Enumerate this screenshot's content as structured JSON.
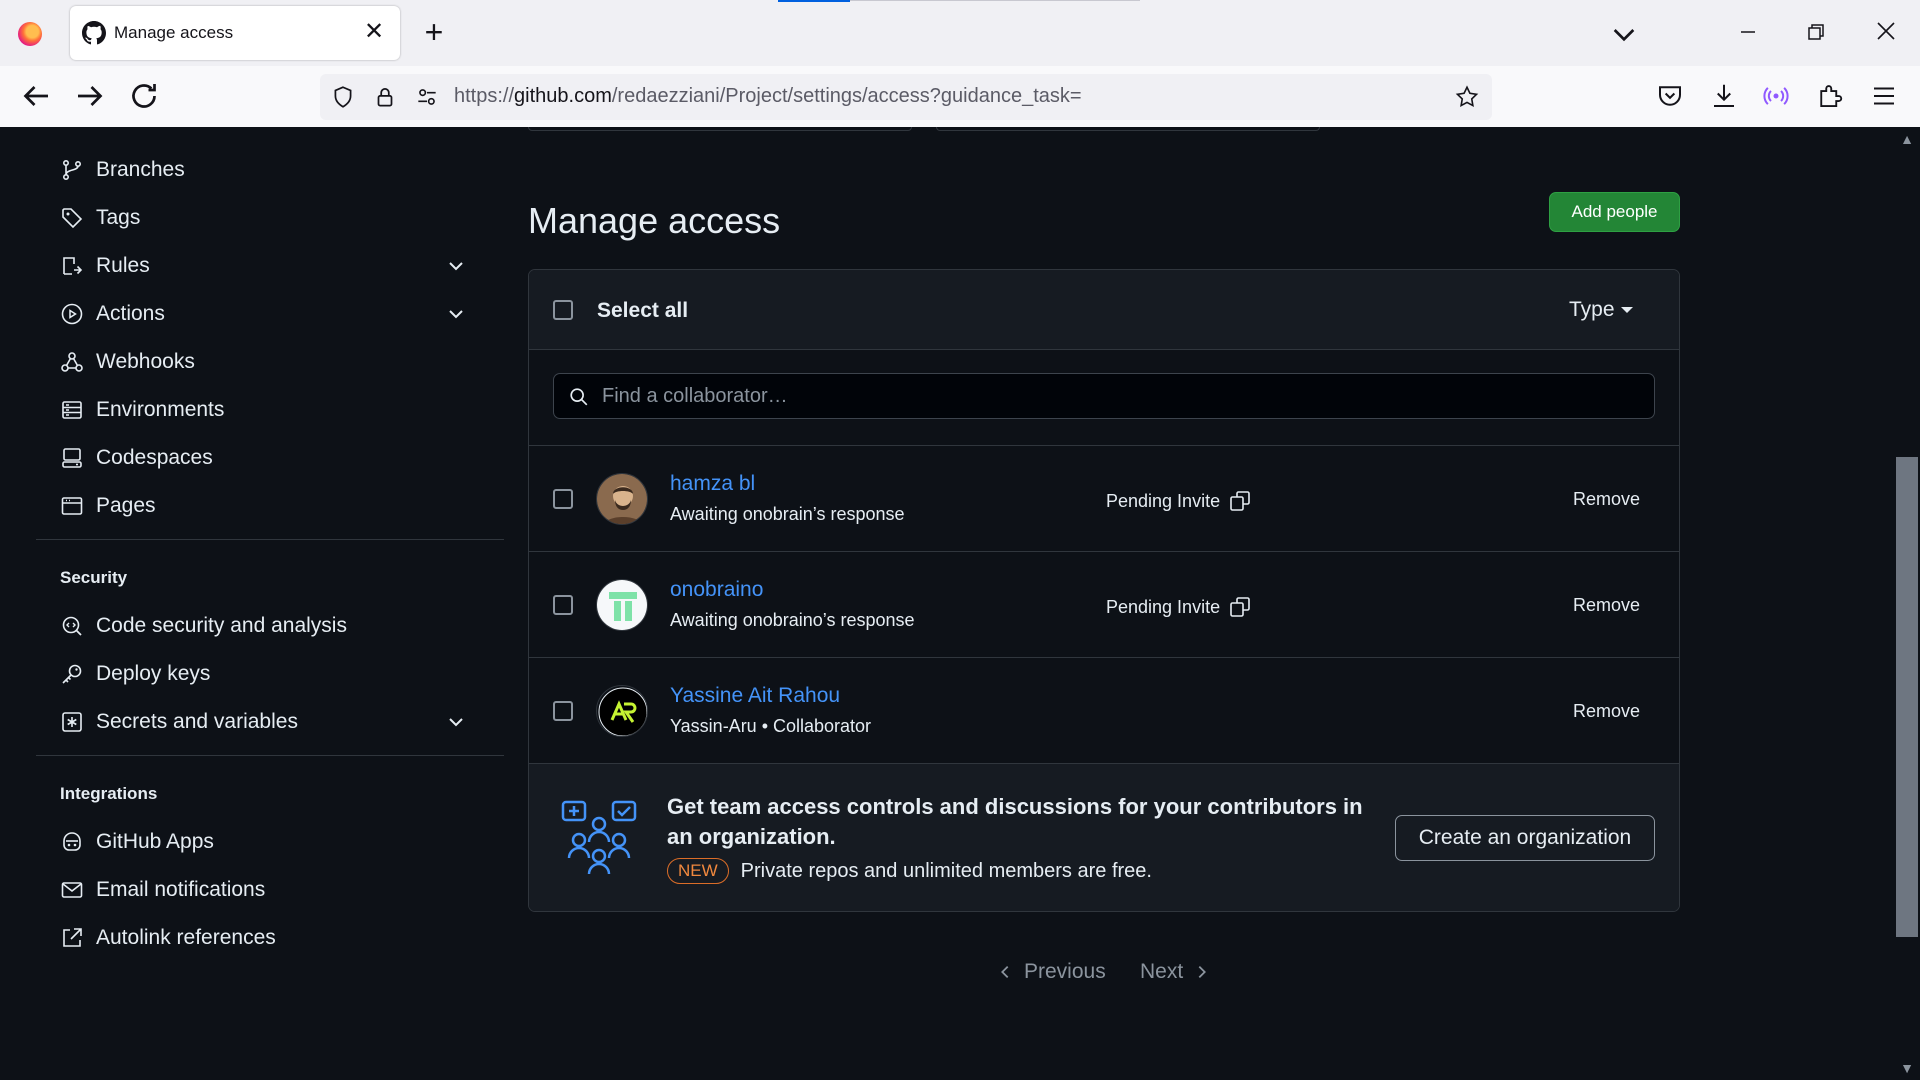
{
  "browser": {
    "tab_title": "Manage access",
    "url_prefix": "https://",
    "url_host": "github.com",
    "url_path": "/redaezziani/Project/settings/access?guidance_task="
  },
  "sidebar": {
    "code_items": [
      {
        "label": "Branches",
        "icon": "git-branch-icon"
      },
      {
        "label": "Tags",
        "icon": "tag-icon"
      },
      {
        "label": "Rules",
        "icon": "rules-icon",
        "expandable": true
      },
      {
        "label": "Actions",
        "icon": "play-icon",
        "expandable": true
      },
      {
        "label": "Webhooks",
        "icon": "webhook-icon"
      },
      {
        "label": "Environments",
        "icon": "server-icon"
      },
      {
        "label": "Codespaces",
        "icon": "codespaces-icon"
      },
      {
        "label": "Pages",
        "icon": "browser-icon"
      }
    ],
    "security_heading": "Security",
    "security_items": [
      {
        "label": "Code security and analysis",
        "icon": "codescan-icon"
      },
      {
        "label": "Deploy keys",
        "icon": "key-icon"
      },
      {
        "label": "Secrets and variables",
        "icon": "asterisk-icon",
        "expandable": true
      }
    ],
    "integrations_heading": "Integrations",
    "integrations_items": [
      {
        "label": "GitHub Apps",
        "icon": "apps-icon"
      },
      {
        "label": "Email notifications",
        "icon": "mail-icon"
      },
      {
        "label": "Autolink references",
        "icon": "link-external-icon"
      }
    ]
  },
  "main": {
    "title": "Manage access",
    "add_people_label": "Add people",
    "select_all_label": "Select all",
    "type_filter_label": "Type",
    "search_placeholder": "Find a collaborator…",
    "collaborators": [
      {
        "name": "hamza bl",
        "subtitle": "Awaiting onobrain’s response",
        "status": "Pending Invite",
        "action": "Remove"
      },
      {
        "name": "onobraino",
        "subtitle": "Awaiting onobraino’s response",
        "status": "Pending Invite",
        "action": "Remove"
      },
      {
        "name": "Yassine Ait Rahou",
        "subtitle": "Yassin-Aru • Collaborator",
        "status": "",
        "action": "Remove"
      }
    ],
    "promo": {
      "text": "Get team access controls and discussions for your contributors in an organization.",
      "badge": "NEW",
      "sub": "Private repos and unlimited members are free.",
      "button": "Create an organization"
    },
    "pagination": {
      "previous": "Previous",
      "next": "Next"
    }
  },
  "colors": {
    "page_bg": "#0d1117",
    "link": "#4493f8",
    "primary_button": "#238636",
    "badge_new": "#db6d28"
  }
}
